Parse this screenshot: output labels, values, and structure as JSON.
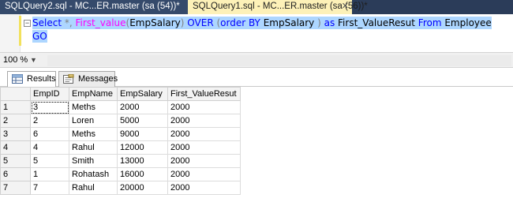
{
  "tabs": [
    {
      "label": "SQLQuery2.sql - MC...ER.master (sa (54))*",
      "active": false
    },
    {
      "label": "SQLQuery1.sql - MC...ER.master (sa (56))*",
      "active": true
    }
  ],
  "editor": {
    "line1": {
      "kw_select": "Select",
      "star": " *, ",
      "fn_first_value": "First_value",
      "open_paren": "(",
      "col_empsalary": "EmpSalary",
      "close_paren": ")",
      "kw_over": " OVER ",
      "open_paren2": "(",
      "kw_order_by": "order BY",
      "col_empsalary2": " EmpSalary ",
      "close_paren2": ")",
      "kw_as": " as ",
      "alias": "First_ValueResut",
      "kw_from": " From ",
      "table": "Employee"
    },
    "line2": "GO"
  },
  "status": {
    "zoom": "100 %"
  },
  "results_tabs": [
    {
      "label": "Results",
      "active": true,
      "icon": "grid-icon"
    },
    {
      "label": "Messages",
      "active": false,
      "icon": "messages-icon"
    }
  ],
  "grid": {
    "columns": [
      "EmpID",
      "EmpName",
      "EmpSalary",
      "First_ValueResut"
    ],
    "rows": [
      {
        "n": "1",
        "cells": [
          "3",
          "Meths",
          "2000",
          "2000"
        ]
      },
      {
        "n": "2",
        "cells": [
          "2",
          "Loren",
          "5000",
          "2000"
        ]
      },
      {
        "n": "3",
        "cells": [
          "6",
          "Meths",
          "9000",
          "2000"
        ]
      },
      {
        "n": "4",
        "cells": [
          "4",
          "Rahul",
          "12000",
          "2000"
        ]
      },
      {
        "n": "5",
        "cells": [
          "5",
          "Smith",
          "13000",
          "2000"
        ]
      },
      {
        "n": "6",
        "cells": [
          "1",
          "Rohatash",
          "16000",
          "2000"
        ]
      },
      {
        "n": "7",
        "cells": [
          "7",
          "Rahul",
          "20000",
          "2000"
        ]
      }
    ]
  },
  "colors": {
    "keyword": "#0000ff",
    "function": "#ff00ff",
    "operator": "#808080",
    "selection": "#add6ff",
    "active_tab": "#fdf1b8",
    "tabstrip": "#2b3c59"
  }
}
